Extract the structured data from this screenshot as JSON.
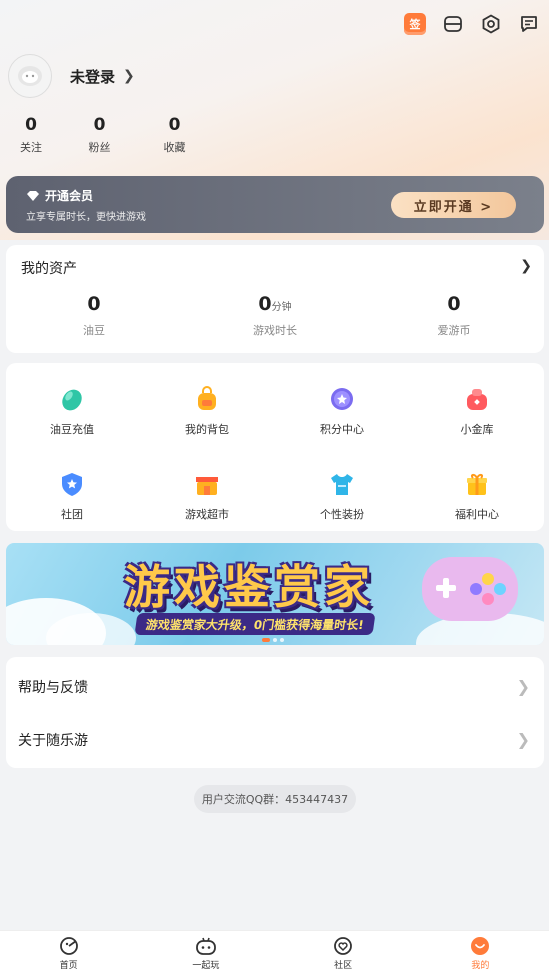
{
  "header": {
    "icons": [
      "sign-in-icon",
      "scan-icon",
      "settings-icon",
      "message-icon"
    ],
    "sign_label": "签"
  },
  "profile": {
    "login_text": "未登录",
    "stats": [
      {
        "value": "0",
        "label": "关注"
      },
      {
        "value": "0",
        "label": "粉丝"
      },
      {
        "value": "0",
        "label": "收藏"
      }
    ]
  },
  "vip": {
    "title": "开通会员",
    "subtitle": "立享专属时长，更快进游戏",
    "button": "立即开通 >"
  },
  "assets": {
    "title": "我的资产",
    "items": [
      {
        "value": "0",
        "unit": "",
        "label": "油豆"
      },
      {
        "value": "0",
        "unit": "分钟",
        "label": "游戏时长"
      },
      {
        "value": "0",
        "unit": "",
        "label": "爱游币"
      }
    ]
  },
  "grid": {
    "items": [
      {
        "label": "油豆充值",
        "icon": "bean-icon"
      },
      {
        "label": "我的背包",
        "icon": "backpack-icon"
      },
      {
        "label": "积分中心",
        "icon": "points-icon"
      },
      {
        "label": "小金库",
        "icon": "vault-icon"
      },
      {
        "label": "社团",
        "icon": "club-icon"
      },
      {
        "label": "游戏超市",
        "icon": "shop-icon"
      },
      {
        "label": "个性装扮",
        "icon": "outfit-icon"
      },
      {
        "label": "福利中心",
        "icon": "gift-icon"
      }
    ]
  },
  "banner": {
    "title": "游戏鉴赏家",
    "subtitle": "游戏鉴赏家大升级，0门槛获得海量时长!"
  },
  "menu": {
    "items": [
      {
        "label": "帮助与反馈"
      },
      {
        "label": "关于随乐游"
      }
    ]
  },
  "qq_group": "用户交流QQ群：453447437",
  "tabbar": {
    "items": [
      {
        "label": "首页",
        "icon": "home-icon"
      },
      {
        "label": "一起玩",
        "icon": "gamepad-icon"
      },
      {
        "label": "社区",
        "icon": "community-icon"
      },
      {
        "label": "我的",
        "icon": "mine-icon",
        "active": true
      }
    ]
  },
  "colors": {
    "accent": "#ff7b3a",
    "vip_bg": "#6b6f7b",
    "page_bg": "#f2f3f5"
  }
}
